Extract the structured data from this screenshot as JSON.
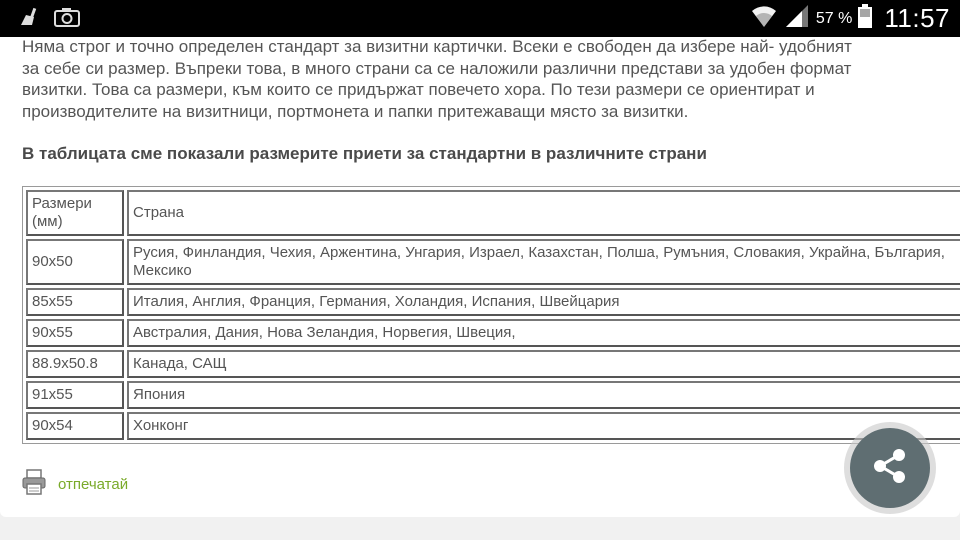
{
  "status_bar": {
    "battery_percent": "57 %",
    "time": "11:57",
    "icons": [
      "cleaner-icon",
      "camera-icon",
      "wifi-icon",
      "signal-icon",
      "battery-icon"
    ]
  },
  "intro_lines": [
    "Няма строг и точно определен стандарт за визитни картички. Всеки е свободен да избере най- удобният",
    "за себе си размер. Въпреки това, в много страни са се наложили различни представи за удобен формат",
    "визитки. Това са размери, към които се придържат повечето хора. По тези размери се ориентират и",
    "производителите на визитници, портмонета и папки притежаващи място за визитки."
  ],
  "lead": "В таблицата сме показали размерите приети за стандартни в различните страни",
  "table": {
    "headers": [
      "Размери (мм)",
      "Страна"
    ],
    "rows": [
      [
        "90x50",
        "Русия, Финландия, Чехия, Аржентина, Унгария, Израел, Казахстан, Полша, Румъния, Словакия, Украйна, България, Мексико"
      ],
      [
        "85x55",
        "Италия, Англия, Франция, Германия, Холандия, Испания, Швейцария"
      ],
      [
        "90x55",
        "Австралия, Дания, Нова Зеландия, Норвегия, Швеция,"
      ],
      [
        "88.9x50.8",
        "Канада, САЩ"
      ],
      [
        "91x55",
        "Япония"
      ],
      [
        "90x54",
        "Хонконг"
      ]
    ]
  },
  "print_label": "отпечатай",
  "colors": {
    "link": "#7aaa2a",
    "share_button": "#5f6e72"
  }
}
